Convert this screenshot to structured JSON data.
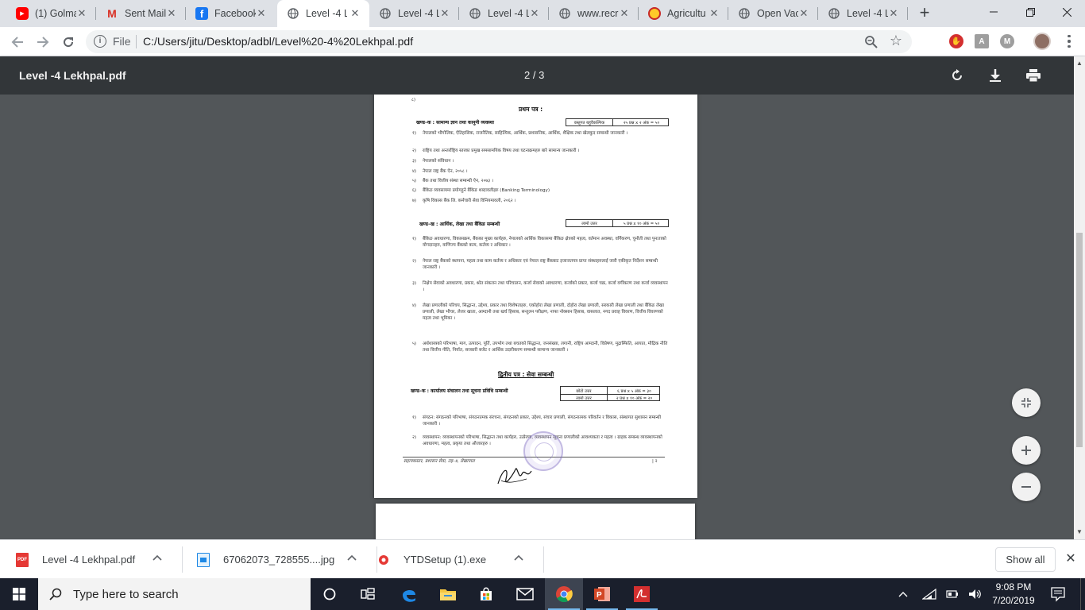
{
  "browser": {
    "tabs": [
      {
        "title": "(1) Golma",
        "icon": "youtube-icon",
        "color": "#ff0000"
      },
      {
        "title": "Sent Mail",
        "icon": "gmail-icon",
        "color": "#d93025"
      },
      {
        "title": "Facebook",
        "icon": "facebook-icon",
        "color": "#1877f2"
      },
      {
        "title": "Level -4 L",
        "icon": "globe-icon",
        "color": "#5f6368",
        "active": true
      },
      {
        "title": "Level -4 L",
        "icon": "globe-icon",
        "color": "#5f6368"
      },
      {
        "title": "Level -4 L",
        "icon": "globe-icon",
        "color": "#5f6368"
      },
      {
        "title": "www.recr",
        "icon": "globe-icon",
        "color": "#5f6368"
      },
      {
        "title": "Agricultu",
        "icon": "agriculture-logo-icon",
        "color": "#c62828"
      },
      {
        "title": "Open Vac",
        "icon": "globe-icon",
        "color": "#5f6368"
      },
      {
        "title": "Level -4 L",
        "icon": "globe-icon",
        "color": "#5f6368"
      }
    ],
    "scheme": "File",
    "url": "C:/Users/jitu/Desktop/adbl/Level%20-4%20Lekhpal.pdf"
  },
  "viewer": {
    "title": "Level -4 Lekhpal.pdf",
    "page_indicator": "2 / 3"
  },
  "document": {
    "page_mark": "८)",
    "paper1_title": "प्रथम पत्र :",
    "sectionA_title": "खण्ड–क : सामान्य ज्ञान तथा कानुनी व्यवस्था",
    "sectionA_box": {
      "type": "वस्तुगत बहुवैकल्पिक",
      "marks": "२५ प्रश्न x २ अंक = ५०"
    },
    "sectionA_items": [
      {
        "n": "१)",
        "text": "नेपालको भौगोलिक, ऐतिहासिक, राजनैतिक, साहित्यिक, आर्थिक, प्रशासनिक, आर्थिक, शैक्षिक तथा खेलकुद सम्बन्धी जानकारी ।"
      },
      {
        "n": "२)",
        "text": "राष्ट्रिय तथा अन्तर्राष्ट्रिय स्तरका प्रमुख समसामयिक विषय तथा घटनाक्रमहरु बारे सामान्य जानकारी ।"
      },
      {
        "n": "३)",
        "text": "नेपालको संविधान ।"
      },
      {
        "n": "४)",
        "text": "नेपाल राष्ट्र बैंक ऐन, २०५८ ।"
      },
      {
        "n": "५)",
        "text": "बैंक तथा वित्तीय संस्था सम्बन्धी ऐन, २०७३ ।"
      },
      {
        "n": "६)",
        "text": "बैंकिङ व्यवसायमा प्रयोगहुने बैंकिङ शब्दावलीहरु (Banking Terminology)"
      },
      {
        "n": "७)",
        "text": "कृषि विकास बैंक लि. कर्मचारी सेवा विनियमावली, २०६२ ।"
      }
    ],
    "sectionB_title": "खण्ड–ख : आर्थिक, लेखा तथा बैंकिङ सम्बन्धी",
    "sectionB_box": {
      "type": "लामो उत्तर",
      "marks": "५ प्रश्न x १० अंक = ५०"
    },
    "sectionB_items": [
      {
        "n": "१)",
        "text": "बैंकिङ अवधारणा, विकासक्रम, बैंकका मुख्य कार्यहरु, नेपालको आर्थिक विकासमा बैंकिङ क्षेत्रको महत्व, वर्तमान अवस्था, वर्गिकरण, चुनौती तथा पुनःताको योगदानहरु, वाणिज्य बैंकको काम, कर्तव्य र अधिकार ।"
      },
      {
        "n": "२)",
        "text": "नेपाल राष्ट्र बैंकको स्थापना, महत्व तथा काम कर्तव्य र अधिकार एवं नेपाल राष्ट्र बैंकबाट इजाजतपत्र प्राप्त संस्थाहरुलाई जारी एकीकृत निर्देशन सम्बन्धी जानकारी ।"
      },
      {
        "n": "३)",
        "text": "निक्षेप सेवाको अवधारणा, प्रकार, श्रोत संकलन तथा परिचालन, कर्जा सेवाको अवधारणा, कर्जाको प्रकार, कर्जा चक्र, कर्जा वर्गीकरण तथा कर्जा व्यवस्थापन ।"
      },
      {
        "n": "४)",
        "text": "लेखा प्रणालीको परिचय, सिद्धान्त, उद्देश्य, प्रकार तथा विशेषताहरु, एकोहोरा लेखा प्रणाली, दोहोरा लेखा प्रणाली, सरकारी लेखा प्रणाली तथा बैंकिङ लेखा प्रणाली, लेखा भौचर, लेजर खाता, आम्दानी तथा खर्च हिसाब, सन्तुलन परीक्षण, नाफा नोक्सान हिसाब, वासलात, नगद प्रवाह विवरण, वित्तीय विवरणको महत्व तथा भूमिका ।"
      },
      {
        "n": "५)",
        "text": "अर्थशास्त्रको परिभाषा, माग, उत्पादन, पूर्ति, उपभोग तथा बचतको सिद्धान्त, जनसंख्या, लगानी, राष्ट्रिय आम्दानी, विप्रेषण, मुद्रास्फिति, आयात, मौद्रिक नीति तथा वित्तीय नीति, निर्यात, सरकारी बजेट र आर्थिक उदारीकरण सम्बन्धी सामान्य जानकारी ।"
      }
    ],
    "paper2_title": "द्वितीय पत्र : सेवा सम्बन्धी",
    "paper2_sectionA_title": "खण्ड–क : कार्यालय संचालन तथा सूचना प्रविधि सम्बन्धी",
    "paper2_box": [
      {
        "type": "छोटो उत्तर",
        "marks": "६ प्रश्न x ५ अंक = ३०"
      },
      {
        "type": "लामो उत्तर",
        "marks": "२ प्रश्न x १० अंक = २०"
      }
    ],
    "paper2_items": [
      {
        "n": "१)",
        "text": "संगठन: संगठनको परिभाषा, संगठनात्मक संरचना, संगठनको प्रकार, उद्देश्य, संचार प्रणाली, संगठनात्मक परिवर्तन र विकास, संस्थागत सुशासन सम्बन्धी जानकारी ।"
      },
      {
        "n": "२)",
        "text": "व्यवस्थापन: व्यवस्थापनको परिभाषा, सिद्धान्त तथा कार्यहरु, उत्प्रेरणा, व्यवस्थापन सूचना प्रणालीको आवश्यकता र महत्व । ग्राहक सम्बन्ध व्यवस्थापनको अवधारणा, महत्व, प्रकृया तथा औजारहरु ।"
      }
    ],
    "footer_left": "सहायकस्तर, प्रशासन सेवा, तह–४, लेखापाल",
    "footer_right": "| २"
  },
  "downloads": [
    {
      "name": "Level -4  Lekhpal.pdf",
      "icon": "pdf-file-icon"
    },
    {
      "name": "67062073_728555....jpg",
      "icon": "image-file-icon"
    },
    {
      "name": "YTDSetup (1).exe",
      "icon": "exe-file-icon"
    }
  ],
  "show_all": "Show all",
  "taskbar": {
    "search_placeholder": "Type here to search",
    "time": "9:08 PM",
    "date": "7/20/2019"
  }
}
